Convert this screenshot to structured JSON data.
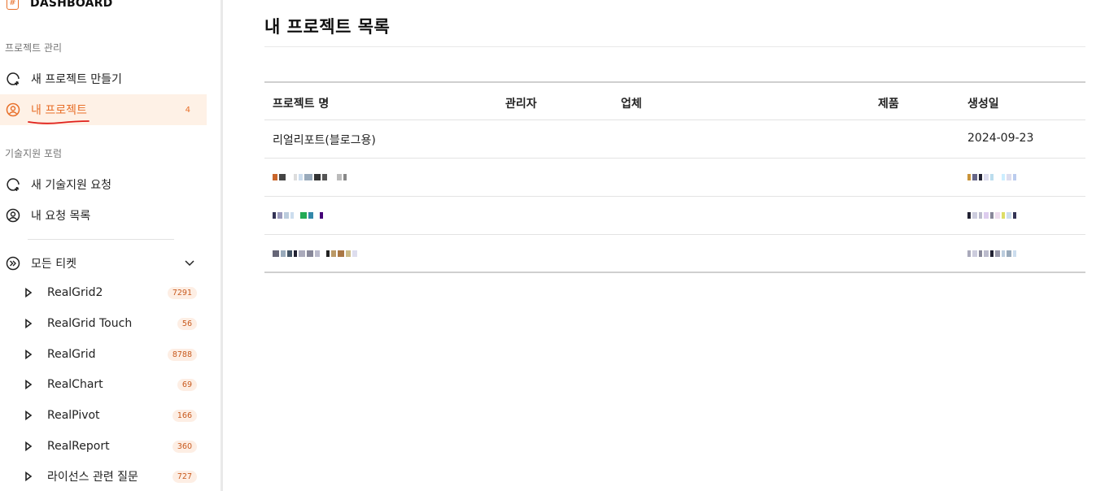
{
  "sidebar": {
    "brand": {
      "label": "DASHBOARD",
      "icon": "hash-icon"
    },
    "sections": [
      {
        "title": "프로젝트 관리",
        "items": [
          {
            "label": "새 프로젝트 만들기",
            "icon": "chat-plus-icon"
          },
          {
            "label": "내 프로젝트",
            "icon": "user-circle-icon",
            "count": "4",
            "active": true
          }
        ]
      },
      {
        "title": "기술지원 포럼",
        "items": [
          {
            "label": "새 기술지원 요청",
            "icon": "chat-plus-icon"
          },
          {
            "label": "내 요청 목록",
            "icon": "user-circle-icon"
          }
        ]
      }
    ],
    "all_tickets": {
      "label": "모든 티켓",
      "icon": "forward-circle-icon",
      "expanded": true,
      "items": [
        {
          "label": "RealGrid2",
          "count": "7291"
        },
        {
          "label": "RealGrid Touch",
          "count": "56"
        },
        {
          "label": "RealGrid",
          "count": "8788"
        },
        {
          "label": "RealChart",
          "count": "69"
        },
        {
          "label": "RealPivot",
          "count": "166"
        },
        {
          "label": "RealReport",
          "count": "360"
        },
        {
          "label": "라이선스 관련 질문",
          "count": "727"
        }
      ]
    }
  },
  "main": {
    "title": "내 프로젝트 목록",
    "table": {
      "columns": [
        "프로젝트 명",
        "관리자",
        "업체",
        "제품",
        "생성일"
      ],
      "rows": [
        {
          "name": "리얼리포트(블로그용)",
          "manager": "",
          "company": "",
          "product": "",
          "created": "2024-09-23"
        },
        {
          "name": "",
          "manager": "",
          "company": "",
          "product": "",
          "created": ""
        },
        {
          "name": "",
          "manager": "",
          "company": "",
          "product": "",
          "created": ""
        },
        {
          "name": "",
          "manager": "",
          "company": "",
          "product": "",
          "created": ""
        }
      ]
    }
  },
  "colors": {
    "accent": "#e8702a",
    "active_bg": "#fef1e6",
    "badge_bg": "#fdeee4"
  }
}
